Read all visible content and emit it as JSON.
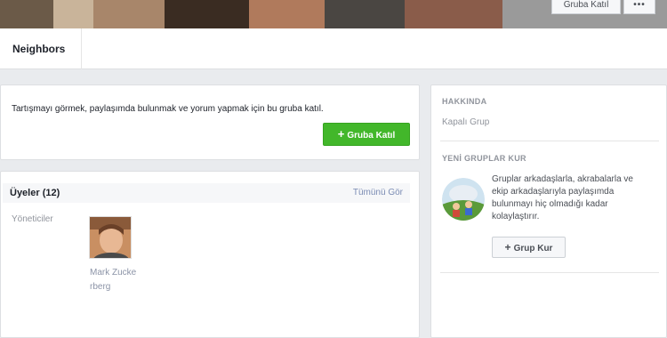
{
  "cover": {
    "join_label": "Gruba Katıl",
    "more_label": "•••"
  },
  "tabs": {
    "group_name": "Neighbors"
  },
  "join_prompt": {
    "message": "Tartışmayı görmek, paylaşımda bulunmak ve yorum yapmak için bu gruba katıl.",
    "button_icon": "+",
    "button_label": "Gruba Katıl"
  },
  "members": {
    "title": "Üyeler (12)",
    "see_all": "Tümünü Gör",
    "admins_label": "Yöneticiler",
    "admin_name": "Mark Zuckerberg"
  },
  "sidebar": {
    "about_title": "HAKKINDA",
    "privacy": "Kapalı Grup",
    "create_title": "YENİ GRUPLAR KUR",
    "create_description": "Gruplar arkadaşlarla, akrabalarla ve ekip arkadaşlarıyla paylaşımda bulunmayı hiç olmadığı kadar kolaylaştırır.",
    "create_button_icon": "+",
    "create_button_label": "Grup Kur"
  },
  "colors": {
    "accent_green": "#42b72a",
    "link": "#7b8cb4",
    "page_bg": "#e9ebee"
  }
}
